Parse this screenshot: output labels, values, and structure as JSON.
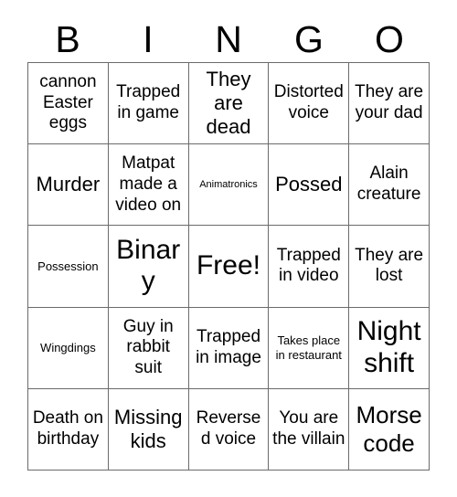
{
  "card": {
    "title": "BINGO",
    "header_letters": [
      "B",
      "I",
      "N",
      "G",
      "O"
    ],
    "grid_size": "5x5",
    "free_space": "Free!",
    "colors": {
      "background": "#ffffff",
      "text": "#000000",
      "grid_line": "#6b6b6b"
    },
    "rows": [
      [
        {
          "text": "cannon Easter eggs",
          "size": "md"
        },
        {
          "text": "Trapped in game",
          "size": "md"
        },
        {
          "text": "They are dead",
          "size": "lg"
        },
        {
          "text": "Distorted voice",
          "size": "md"
        },
        {
          "text": "They are your dad",
          "size": "md"
        }
      ],
      [
        {
          "text": "Murder",
          "size": "lg"
        },
        {
          "text": "Matpat made a video on",
          "size": "md"
        },
        {
          "text": "Animatronics",
          "size": "xs"
        },
        {
          "text": "Possed",
          "size": "lg"
        },
        {
          "text": "Alain creature",
          "size": "md"
        }
      ],
      [
        {
          "text": "Possession",
          "size": "sm"
        },
        {
          "text": "Binary",
          "size": "xxl"
        },
        {
          "text": "Free!",
          "size": "xxl"
        },
        {
          "text": "Trapped in video",
          "size": "md"
        },
        {
          "text": "They are lost",
          "size": "md"
        }
      ],
      [
        {
          "text": "Wingdings",
          "size": "sm"
        },
        {
          "text": "Guy in rabbit suit",
          "size": "md"
        },
        {
          "text": "Trapped in image",
          "size": "md"
        },
        {
          "text": "Takes place in restaurant",
          "size": "sm"
        },
        {
          "text": "Night shift",
          "size": "xxl"
        }
      ],
      [
        {
          "text": "Death on birthday",
          "size": "md"
        },
        {
          "text": "Missing kids",
          "size": "lg"
        },
        {
          "text": "Reversed voice",
          "size": "md"
        },
        {
          "text": "You are the villain",
          "size": "md"
        },
        {
          "text": "Morse code",
          "size": "xl"
        }
      ]
    ]
  }
}
